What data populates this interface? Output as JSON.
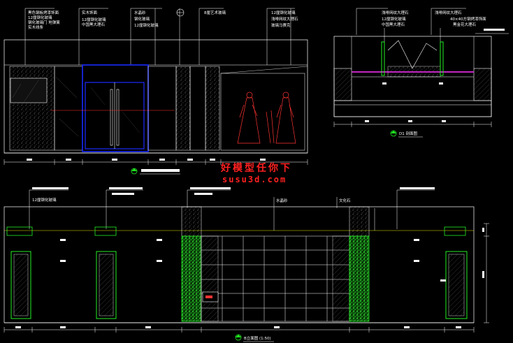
{
  "colors": {
    "background": "#000000",
    "line": "#ffffff",
    "blue": "#1a2aff",
    "green": "#22ee22",
    "magenta": "#ff33ff",
    "red": "#ff3333",
    "yellow": "#e6e600",
    "gray": "#9a9a9a"
  },
  "view1": {
    "notes_col1": [
      "黑色钢板烤漆饰面",
      "12厘钢化玻璃",
      "钢化玻璃门 地弹簧",
      "实木线条"
    ],
    "notes_col2": [
      "实木饰面",
      "12厘钢化玻璃",
      "中国黑大理石"
    ],
    "notes_col3": [
      "水晶砂",
      "钢化玻璃",
      "12厘钢化玻璃"
    ],
    "notes_col4": [
      "8厘艺术玻璃"
    ],
    "notes_col5": [
      "12厘钢化玻璃",
      "浅啡网纹大理石",
      "玻璃马赛克"
    ]
  },
  "view2": {
    "notes_col1": [
      "浅啡网纹大理石",
      "12厘钢化玻璃",
      "中国黑大理石"
    ],
    "notes_col2": [
      "浅啡网纹大理石",
      "40×40方钢烤漆饰面",
      "黑金花大理石"
    ],
    "title": "D1 剖面图"
  },
  "view3": {
    "notes_left": [
      "12厘钢化玻璃"
    ],
    "note_center": "水晶砂",
    "note_right": "文化石",
    "title": "B立面图 (1:50)"
  },
  "watermark": {
    "line1": "好模型任你下",
    "line2": "susu3d.com"
  }
}
